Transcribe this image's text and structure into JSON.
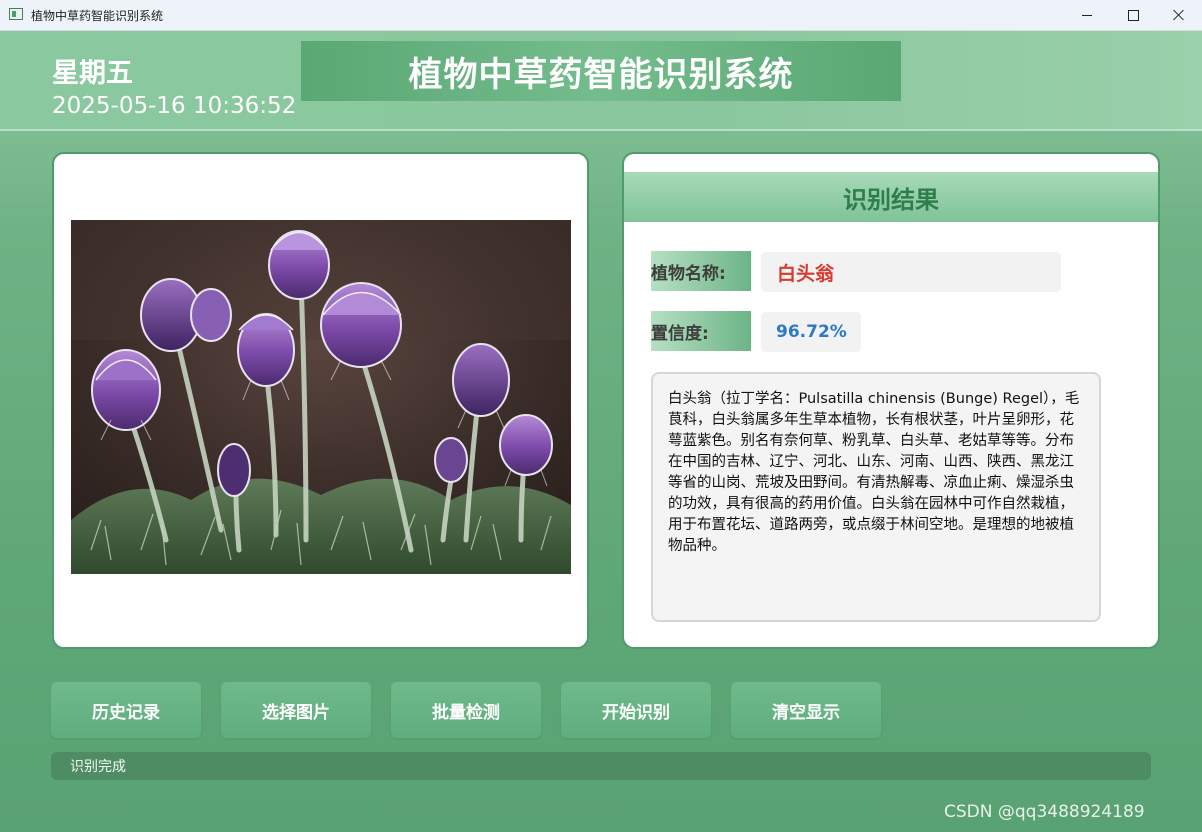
{
  "window": {
    "title": "植物中草药智能识别系统",
    "icon": "app-window-icon",
    "controls": [
      "minimize-icon",
      "maximize-icon",
      "close-icon"
    ]
  },
  "header": {
    "weekday": "星期五",
    "datetime": "2025-05-16 10:36:52",
    "title": "植物中草药智能识别系统"
  },
  "image_panel": {
    "photo_subject": "purple pasque flowers (Pulsatilla chinensis)"
  },
  "result": {
    "heading": "识别结果",
    "name_label": "植物名称:",
    "name_value": "白头翁",
    "confidence_label": "置信度:",
    "confidence_value": "96.72%",
    "description": "白头翁（拉丁学名：Pulsatilla chinensis (Bunge) Regel），毛茛科，白头翁属多年生草本植物，长有根状茎，叶片呈卵形，花萼蓝紫色。别名有奈何草、粉乳草、白头草、老姑草等等。分布在中国的吉林、辽宁、河北、山东、河南、山西、陕西、黑龙江等省的山岗、荒坡及田野间。有清热解毒、凉血止痢、燥湿杀虫的功效，具有很高的药用价值。白头翁在园林中可作自然栽植，用于布置花坛、道路两旁，或点缀于林间空地。是理想的地被植物品种。"
  },
  "buttons": {
    "history": "历史记录",
    "select_image": "选择图片",
    "batch_detect": "批量检测",
    "start_recognition": "开始识别",
    "clear_display": "清空显示"
  },
  "status": {
    "text": "识别完成"
  },
  "watermark": "CSDN @qq3488924189",
  "colors": {
    "theme_green": "#5fa779",
    "name_red": "#d83a2e",
    "confidence_blue": "#2d78c8",
    "heading_green": "#2f7d4a"
  }
}
